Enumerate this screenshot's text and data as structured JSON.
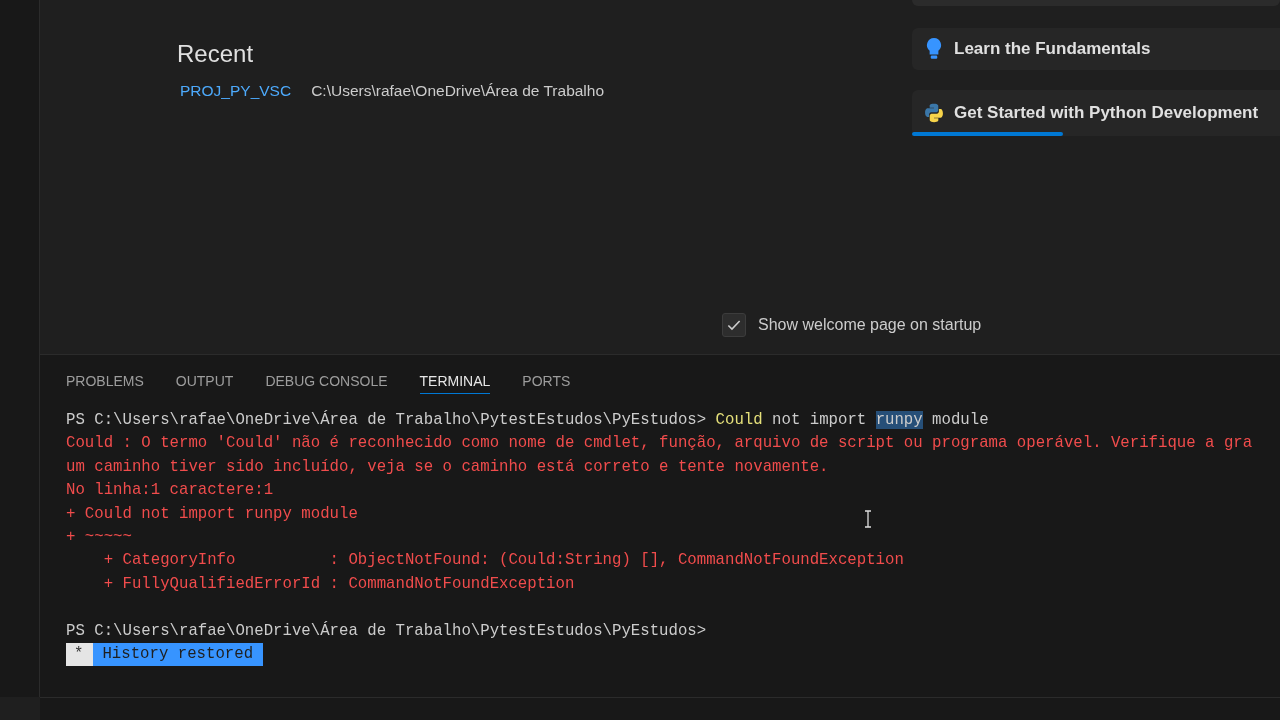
{
  "recent": {
    "title": "Recent",
    "items": [
      {
        "name": "PROJ_PY_VSC",
        "path": "C:\\Users\\rafae\\OneDrive\\Área de Trabalho"
      }
    ]
  },
  "walkthroughs": [
    {
      "title": "Learn the Fundamentals",
      "kind": "bulb"
    },
    {
      "title": "Get Started with Python Development",
      "kind": "python",
      "level": 0.41
    }
  ],
  "startup_checkbox": {
    "label": "Show welcome page on startup",
    "checked": true
  },
  "panel_tabs": [
    {
      "label": "PROBLEMS",
      "selected": false
    },
    {
      "label": "OUTPUT",
      "selected": false
    },
    {
      "label": "DEBUG CONSOLE",
      "selected": false
    },
    {
      "label": "TERMINAL",
      "selected": true
    },
    {
      "label": "PORTS",
      "selected": false
    }
  ],
  "terminal": {
    "lines": [
      {
        "segments": [
          {
            "kind": "prompt",
            "text": "PS C:\\Users\\rafae\\OneDrive\\Área de Trabalho\\PytestEstudos\\PyEstudos> "
          },
          {
            "kind": "command",
            "text": "Could"
          },
          {
            "kind": "plain",
            "text": " not import "
          },
          {
            "kind": "selection",
            "text": "runpy"
          },
          {
            "kind": "plain",
            "text": " module"
          }
        ]
      },
      {
        "segments": [
          {
            "kind": "error",
            "text": "Could : O termo 'Could' não é reconhecido como nome de cmdlet, função, arquivo de script ou programa operável. Verifique a gra"
          }
        ]
      },
      {
        "segments": [
          {
            "kind": "error",
            "text": "um caminho tiver sido incluído, veja se o caminho está correto e tente novamente."
          }
        ]
      },
      {
        "segments": [
          {
            "kind": "error",
            "text": "No linha:1 caractere:1"
          }
        ]
      },
      {
        "segments": [
          {
            "kind": "error",
            "text": "+ Could not import runpy module"
          }
        ]
      },
      {
        "segments": [
          {
            "kind": "error",
            "text": "+ ~~~~~"
          }
        ]
      },
      {
        "segments": [
          {
            "kind": "error",
            "text": "    + CategoryInfo          : ObjectNotFound: (Could:String) [], CommandNotFoundException"
          }
        ]
      },
      {
        "segments": [
          {
            "kind": "error",
            "text": "    + FullyQualifiedErrorId : CommandNotFoundException"
          }
        ]
      },
      {
        "segments": [
          {
            "kind": "prompt",
            "text": "PS C:\\Users\\rafae\\OneDrive\\Área de Trabalho\\PytestEstudos\\PyEstudos>"
          }
        ]
      }
    ],
    "history_badge": {
      "mark": "*",
      "text": "History restored"
    }
  }
}
